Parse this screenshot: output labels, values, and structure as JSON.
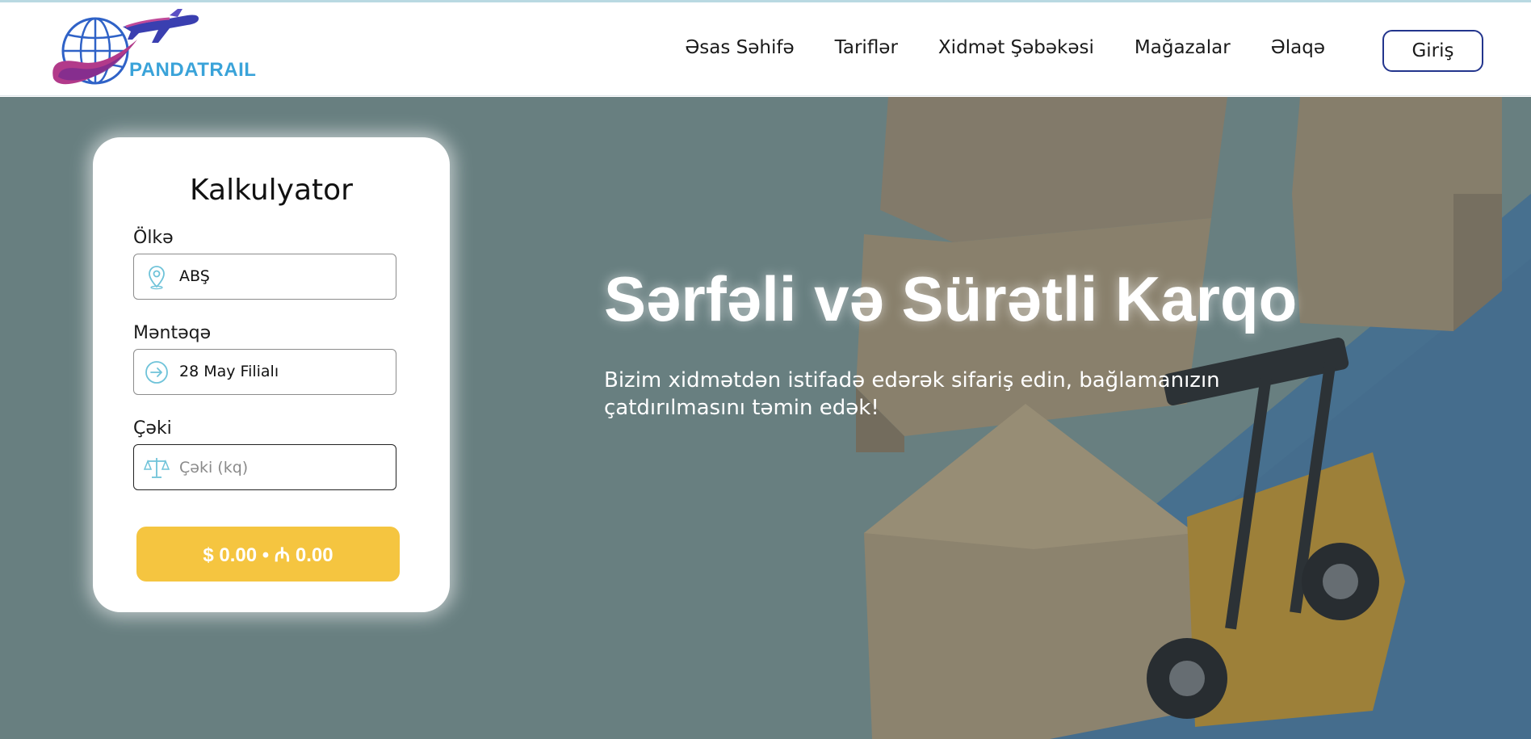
{
  "brand": {
    "name": "PANDATRAIL",
    "colors": {
      "primary": "#3aa3d9",
      "accent": "#23358d",
      "magenta": "#b23a8a"
    }
  },
  "nav": {
    "items": [
      {
        "label": "Əsas Səhifə"
      },
      {
        "label": "Tariflər"
      },
      {
        "label": "Xidmət Şəbəkəsi"
      },
      {
        "label": "Mağazalar"
      },
      {
        "label": "Əlaqə"
      }
    ],
    "login_label": "Giriş"
  },
  "calculator": {
    "title": "Kalkulyator",
    "country": {
      "label": "Ölkə",
      "value": "ABŞ",
      "icon": "location-pin-icon"
    },
    "branch": {
      "label": "Məntəqə",
      "value": "28 May Filialı",
      "icon": "arrow-circle-icon"
    },
    "weight": {
      "label": "Çəki",
      "placeholder": "Çəki (kq)",
      "value": "",
      "icon": "scale-icon"
    },
    "result_label": "$ 0.00 • ₼ 0.00",
    "button_color": "#f5c540"
  },
  "hero": {
    "title": "Sərfəli və Sürətli Karqo",
    "subtitle_line1": "Bizim xidmətdən istifadə edərək sifariş edin, bağlamanızın",
    "subtitle_line2": "çatdırılmasını təmin edək!"
  }
}
